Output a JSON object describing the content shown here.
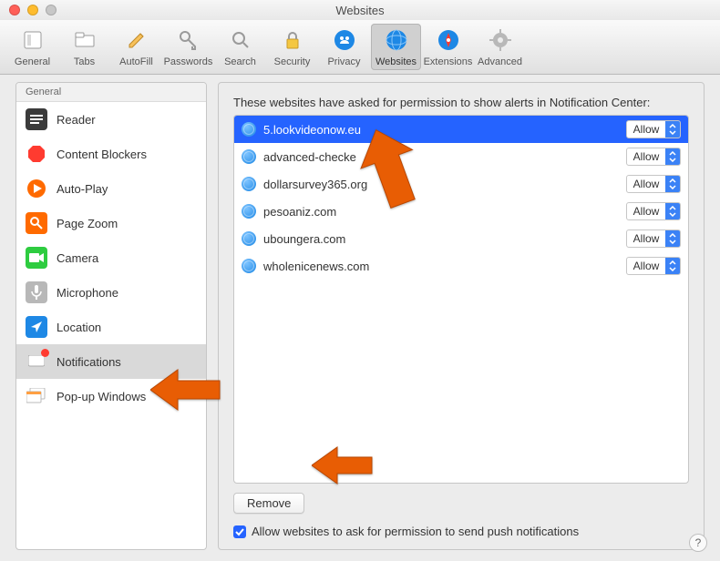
{
  "window": {
    "title": "Websites"
  },
  "toolbar": {
    "items": [
      {
        "label": "General"
      },
      {
        "label": "Tabs"
      },
      {
        "label": "AutoFill"
      },
      {
        "label": "Passwords"
      },
      {
        "label": "Search"
      },
      {
        "label": "Security"
      },
      {
        "label": "Privacy"
      },
      {
        "label": "Websites"
      },
      {
        "label": "Extensions"
      },
      {
        "label": "Advanced"
      }
    ]
  },
  "sidebar": {
    "header": "General",
    "items": [
      {
        "label": "Reader"
      },
      {
        "label": "Content Blockers"
      },
      {
        "label": "Auto-Play"
      },
      {
        "label": "Page Zoom"
      },
      {
        "label": "Camera"
      },
      {
        "label": "Microphone"
      },
      {
        "label": "Location"
      },
      {
        "label": "Notifications"
      },
      {
        "label": "Pop-up Windows"
      }
    ]
  },
  "content": {
    "description": "These websites have asked for permission to show alerts in Notification Center:",
    "rows": [
      {
        "site": "5.lookvideonow.eu",
        "permission": "Allow",
        "selected": true
      },
      {
        "site": "advanced-checke",
        "permission": "Allow",
        "selected": false
      },
      {
        "site": "dollarsurvey365.org",
        "permission": "Allow",
        "selected": false
      },
      {
        "site": "pesoaniz.com",
        "permission": "Allow",
        "selected": false
      },
      {
        "site": "uboungera.com",
        "permission": "Allow",
        "selected": false
      },
      {
        "site": "wholenicenews.com",
        "permission": "Allow",
        "selected": false
      }
    ],
    "remove_label": "Remove",
    "checkbox_label": "Allow websites to ask for permission to send push notifications",
    "checkbox_checked": true
  },
  "help": {
    "label": "?"
  }
}
